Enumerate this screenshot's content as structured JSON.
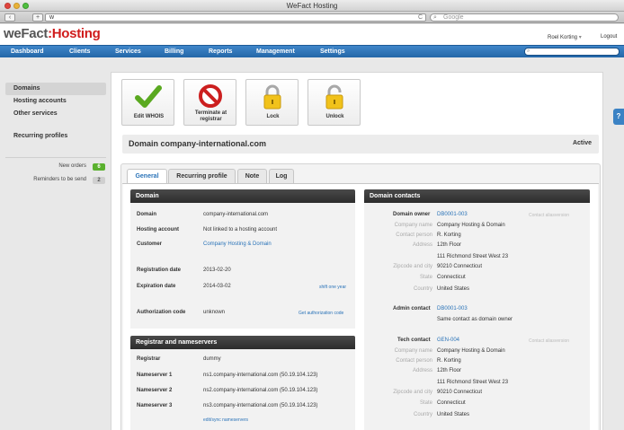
{
  "window": {
    "title": "WeFact Hosting"
  },
  "browser": {
    "back": "‹",
    "forward": "+",
    "url": "w",
    "reload": "C",
    "search_placeholder": "Google"
  },
  "app": {
    "logo_main": "weFact",
    "logo_sep": ":",
    "logo_accent": "Hosting",
    "user_name": "Roel Korting",
    "user_caret": "▾",
    "logout_label": "Logout"
  },
  "menu": {
    "items": [
      "Dashboard",
      "Clients",
      "Services",
      "Billing",
      "Reports",
      "Management",
      "Settings"
    ],
    "search_value": ""
  },
  "sidebar": {
    "items": [
      "Domains",
      "Hosting accounts",
      "Other services",
      "Recurring profiles"
    ],
    "new_orders_label": "New orders",
    "new_orders_count": "6",
    "reminders_label": "Reminders to be send",
    "reminders_count": "2"
  },
  "actions": [
    {
      "label1": "Edit WHOIS",
      "label2": ""
    },
    {
      "label1": "Terminate at",
      "label2": "registrar"
    },
    {
      "label1": "Lock",
      "label2": ""
    },
    {
      "label1": "Unlock",
      "label2": ""
    }
  ],
  "domain": {
    "title": "Domain company-international.com",
    "status": "Active"
  },
  "tabs": [
    "General",
    "Recurring profile",
    "Note",
    "Log"
  ],
  "domain_section": {
    "heading": "Domain",
    "rows": {
      "domain_label": "Domain",
      "domain_value": "company-international.com",
      "hosting_label": "Hosting account",
      "hosting_value": "Not linked to a hosting account",
      "customer_label": "Customer",
      "customer_value": "Company Hosting & Domain",
      "regdate_label": "Registration date",
      "regdate_value": "2013-02-20",
      "expdate_label": "Expiration date",
      "expdate_value": "2014-03-02",
      "expdate_link": "shift one year",
      "auth_label": "Authorization code",
      "auth_value": "unknown",
      "auth_link": "Get authorization code"
    }
  },
  "registrar_section": {
    "heading": "Registrar and nameservers",
    "registrar_label": "Registrar",
    "registrar_value": "dummy",
    "ns1_label": "Nameserver 1",
    "ns1_value": "ns1.company-international.com (50.19.104.123)",
    "ns2_label": "Nameserver 2",
    "ns2_value": "ns2.company-international.com (50.19.104.123)",
    "ns3_label": "Nameserver 3",
    "ns3_value": "ns3.company-international.com (50.19.104.123)",
    "edit_link": "edit/sync nameservers"
  },
  "contacts_section": {
    "heading": "Domain contacts",
    "owner": {
      "label": "Domain owner",
      "id": "DB0001-003",
      "note": "Contact aliasversion",
      "company_lbl": "Company name",
      "company": "Company Hosting & Domain",
      "person_lbl": "Contact person",
      "person": "R. Korting",
      "address_lbl": "Address",
      "address1": "12th Floor",
      "address2": "111 Richmond Street West 23",
      "zip_lbl": "Zipcode and city",
      "zip": "90210 Connecticut",
      "state_lbl": "State",
      "state": "Connecticut",
      "country_lbl": "Country",
      "country": "United States"
    },
    "admin": {
      "label": "Admin contact",
      "id": "DB0001-003",
      "same": "Same contact as domain owner"
    },
    "tech": {
      "label": "Tech contact",
      "id": "GEN-004",
      "note": "Contact aliasversion",
      "company_lbl": "Company name",
      "company": "Company Hosting & Domain",
      "person_lbl": "Contact person",
      "person": "R. Korting",
      "address_lbl": "Address",
      "address1": "12th Floor",
      "address2": "111 Richmond Street West 23",
      "zip_lbl": "Zipcode and city",
      "zip": "90210 Connecticut",
      "state_lbl": "State",
      "state": "Connecticut",
      "country_lbl": "Country",
      "country": "United States"
    }
  },
  "help": "?",
  "colors": {
    "brand_red": "#d01c1c",
    "menu_blue": "#2f74b9",
    "link_blue": "#2a73b8",
    "badge_green": "#5ab12e"
  },
  "icons": [
    "checkmark-icon",
    "no-entry-icon",
    "padlock-closed-icon",
    "padlock-open-icon",
    "search-icon",
    "help-icon"
  ]
}
